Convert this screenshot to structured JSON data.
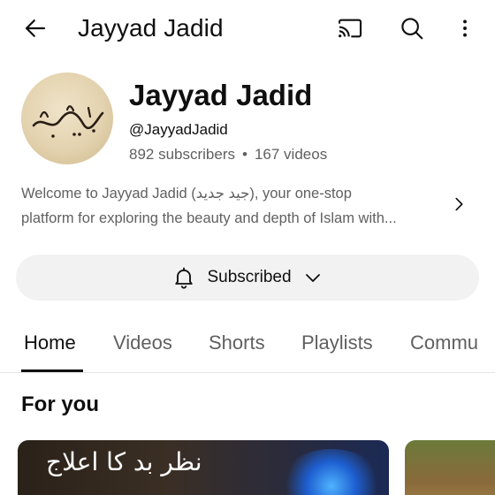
{
  "topbar": {
    "title": "Jayyad Jadid",
    "back_icon": "arrow-left-icon",
    "cast_icon": "cast-icon",
    "search_icon": "search-icon",
    "more_icon": "more-vertical-icon"
  },
  "channel": {
    "name": "Jayyad Jadid",
    "handle": "@JayyadJadid",
    "subscribers": "892 subscribers",
    "separator": "•",
    "videos": "167 videos",
    "avatar_text": "جید جدید",
    "description_line1": "Welcome to Jayyad Jadid (جید جدید), your one-stop",
    "description_line2": "platform for exploring the beauty and depth of Islam with..."
  },
  "subscribe": {
    "label": "Subscribed",
    "bell_icon": "bell-icon",
    "chevron_icon": "chevron-down-icon"
  },
  "tabs": [
    {
      "label": "Home",
      "active": true
    },
    {
      "label": "Videos",
      "active": false
    },
    {
      "label": "Shorts",
      "active": false
    },
    {
      "label": "Playlists",
      "active": false
    },
    {
      "label": "Commu",
      "active": false
    }
  ],
  "section": {
    "title": "For you"
  },
  "videos": [
    {
      "thumbnail_text": "نظر بد کا اعلاج"
    }
  ],
  "colors": {
    "text_primary": "#0f0f0f",
    "text_secondary": "#606060",
    "button_bg": "#f2f2f2"
  }
}
